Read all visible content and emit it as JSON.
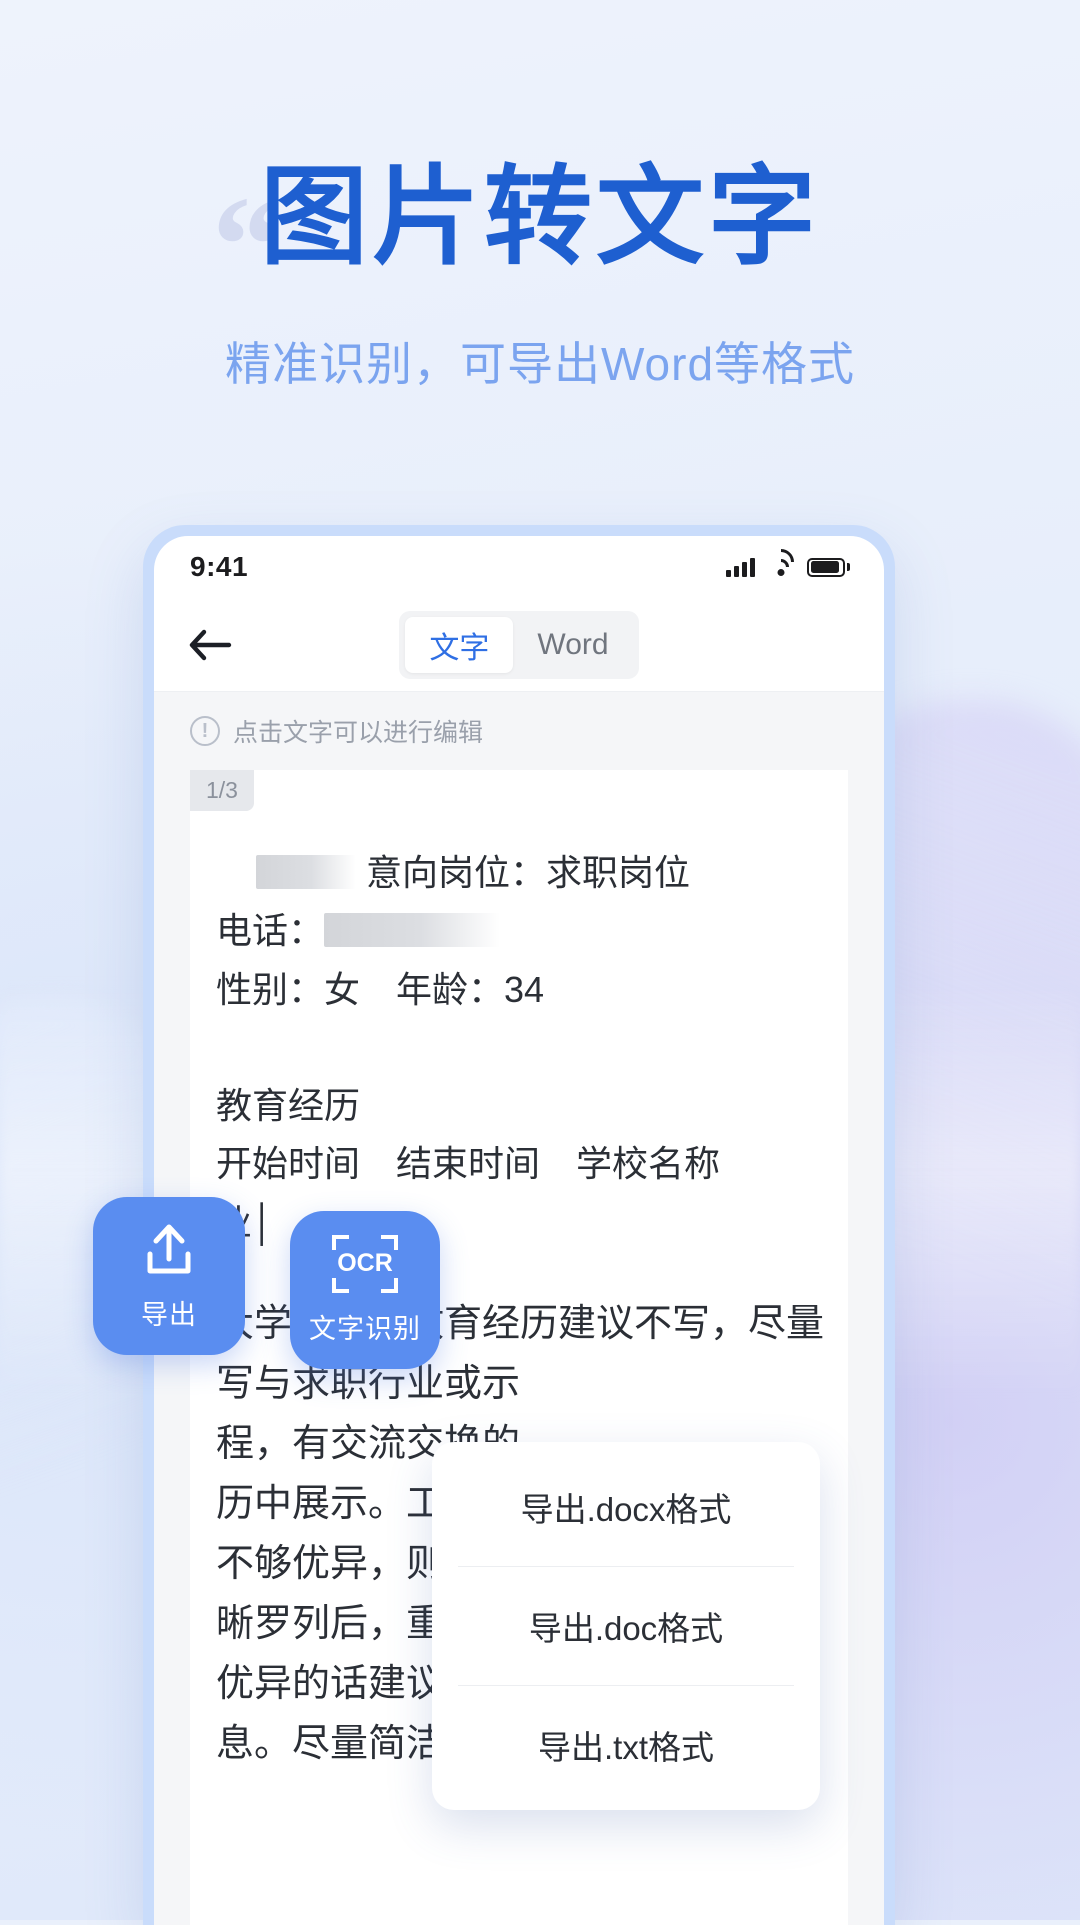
{
  "hero": {
    "quote_mark": "“",
    "title": "图片转文字",
    "subtitle": "精准识别，可导出Word等格式",
    "title_color": "#1e5fd0",
    "subtitle_color": "#7ba4ef"
  },
  "statusbar": {
    "time": "9:41",
    "signal_icon": "cellular-signal-icon",
    "wifi_icon": "wifi-icon",
    "battery_icon": "battery-icon"
  },
  "app_header": {
    "back_icon": "back-arrow-icon",
    "tabs": [
      {
        "label": "文字",
        "active": true
      },
      {
        "label": "Word",
        "active": false
      }
    ]
  },
  "hint": {
    "icon": "exclamation-circle-icon",
    "text": "点击文字可以进行编辑"
  },
  "document": {
    "page_badge": "1/3",
    "lines": [
      "意向岗位：求职岗位",
      "电话：",
      "性别：女　年龄：34",
      "教育经历",
      "开始时间　结束时间　学校名称",
      "业│"
    ],
    "paragraph": [
      "大学之前的教育经历建议不写，尽量",
      "写与求职行业或示",
      "程，有交流交换的",
      "历中展示。工作年",
      "不够优异，则可以",
      "晰罗列后，重点主",
      "优异的话建议写上GPA及排名等信",
      "息。尽量简洁"
    ]
  },
  "fab": {
    "export": {
      "label": "导出",
      "icon": "upload-icon"
    },
    "ocr": {
      "label": "文字识别",
      "icon": "ocr-scan-icon",
      "badge": "OCR"
    },
    "color": "#5a8df0"
  },
  "export_menu": {
    "items": [
      "导出.docx格式",
      "导出.doc格式",
      "导出.txt格式"
    ]
  }
}
